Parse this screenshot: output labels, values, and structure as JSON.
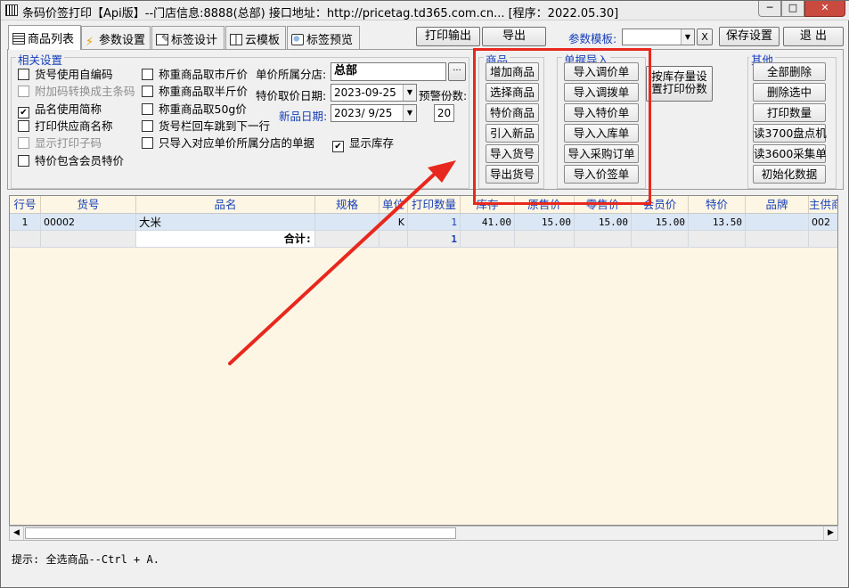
{
  "window": {
    "title": "条码价签打印【Api版】--门店信息:8888(总部) 接口地址：http://pricetag.td365.com.cn... [程序：2022.05.30]",
    "min_glyph": "─",
    "max_glyph": "□",
    "close_glyph": "✕"
  },
  "tabs": [
    {
      "label": "商品列表",
      "icon": "list-icon"
    },
    {
      "label": "参数设置",
      "icon": "lightning-icon"
    },
    {
      "label": "标签设计",
      "icon": "edit-icon"
    },
    {
      "label": "云模板",
      "icon": "window-icon"
    },
    {
      "label": "标签预览",
      "icon": "preview-icon"
    }
  ],
  "toolbar": {
    "print_output": "打印输出",
    "export": "导出",
    "param_template_label": "参数模板:",
    "param_template_value": "",
    "clear_x": "X",
    "save_settings": "保存设置",
    "exit": "退 出"
  },
  "settings": {
    "legend": "相关设置",
    "checkboxes_col1": [
      {
        "label": "货号使用自编码",
        "checked": false,
        "disabled": false
      },
      {
        "label": "附加码转换成主条码",
        "checked": false,
        "disabled": true
      },
      {
        "label": "品名使用简称",
        "checked": true,
        "disabled": false
      },
      {
        "label": "打印供应商名称",
        "checked": false,
        "disabled": false
      },
      {
        "label": "显示打印子码",
        "checked": false,
        "disabled": true
      },
      {
        "label": "特价包含会员特价",
        "checked": false,
        "disabled": false
      }
    ],
    "checkboxes_col2": [
      {
        "label": "称重商品取市斤价",
        "checked": false
      },
      {
        "label": "称重商品取半斤价",
        "checked": false
      },
      {
        "label": "称重商品取50g价",
        "checked": false
      },
      {
        "label": "货号栏回车跳到下一行",
        "checked": false
      },
      {
        "label": "只导入对应单价所属分店的单据",
        "checked": false
      }
    ],
    "branch_label": "单价所属分店:",
    "branch_value": "总部",
    "ellipsis": "···",
    "special_date_label": "特价取价日期:",
    "special_date_value": "2023-09-25",
    "warn_count_label": "预警份数:",
    "warn_count_value": "20",
    "new_date_label": "新品日期:",
    "new_date_value": "2023/ 9/25",
    "show_stock_label": "显示库存",
    "show_stock_checked": true,
    "check_mark": "✔"
  },
  "goods_group": {
    "legend": "商品",
    "buttons": [
      "增加商品",
      "选择商品",
      "特价商品",
      "引入新品",
      "导入货号",
      "导出货号"
    ]
  },
  "import_group": {
    "legend": "单据导入",
    "buttons": [
      "导入调价单",
      "导入调拨单",
      "导入特价单",
      "导入入库单",
      "导入采购订单",
      "导入价签单"
    ]
  },
  "stock_print_button": "按库存量设置打印份数",
  "other_group": {
    "legend": "其他",
    "buttons": [
      "全部删除",
      "删除选中",
      "打印数量",
      "读3700盘点机",
      "读3600采集单",
      "初始化数据"
    ]
  },
  "grid": {
    "columns": [
      "行号",
      "货号",
      "品名",
      "规格",
      "单位",
      "打印数量",
      "库存",
      "原售价",
      "零售价",
      "会员价",
      "特价",
      "品牌",
      "主供商"
    ],
    "rows": [
      {
        "row_no": "1",
        "sku": "00002",
        "name": "大米",
        "spec": "",
        "unit": "K",
        "print_qty": "1",
        "stock": "41.00",
        "orig_price": "15.00",
        "retail_price": "15.00",
        "member_price": "15.00",
        "special_price": "13.50",
        "brand": "",
        "supplier": "002"
      }
    ],
    "total_label": "合计:",
    "total_qty": "1"
  },
  "status": {
    "hint": "提示: 全选商品--Ctrl + A."
  },
  "scroll": {
    "left_arrow": "◀",
    "right_arrow": "▶"
  },
  "colors": {
    "annotation": "#e8281e",
    "grid_bg": "#fef6e4",
    "selected_row": "#dbe7f5",
    "header_text": "#1740b8"
  }
}
